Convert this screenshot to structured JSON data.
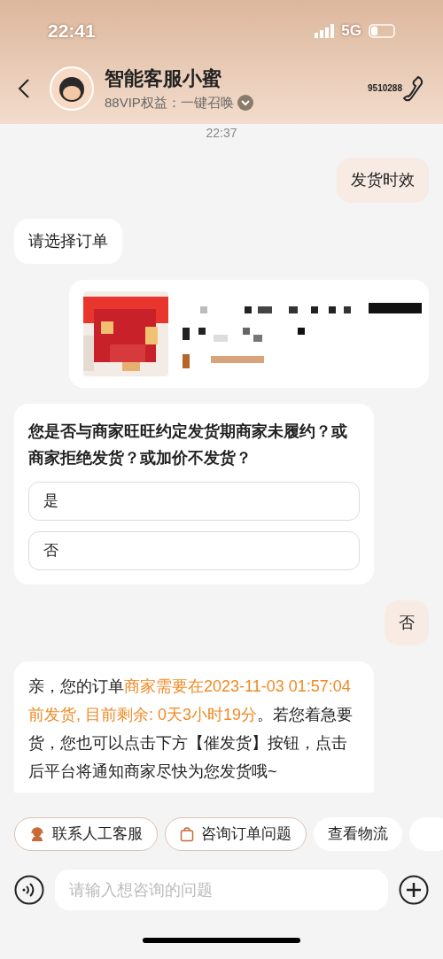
{
  "status_bar": {
    "time": "22:41",
    "network": "5G"
  },
  "header": {
    "title": "智能客服小蜜",
    "subtitle": "88VIP权益：一键召唤",
    "hotline": "9510288"
  },
  "timestamp": "22:37",
  "messages": [
    {
      "kind": "user_text",
      "text": "发货时效"
    },
    {
      "kind": "bot_text",
      "text": "请选择订单"
    },
    {
      "kind": "order_card"
    },
    {
      "kind": "bot_question",
      "text": "您是否与商家旺旺约定发货期商家未履约？或商家拒绝发货？或加价不发货？",
      "options": [
        "是",
        "否"
      ]
    },
    {
      "kind": "user_text",
      "text": "否"
    },
    {
      "kind": "bot_rich",
      "segments": [
        {
          "kind": "plain",
          "text": "亲，您的订单"
        },
        {
          "kind": "highlight",
          "text": "商家需要在2023-11-03 01:57:04前发货, 目前剩余: 0天3小时19分"
        },
        {
          "kind": "plain",
          "text": "。若您着急要货，您也可以点击下方【催发货】按钮，点击后平台将通知商家尽快为您发货哦~"
        }
      ]
    }
  ],
  "quick_replies": [
    {
      "kind": "agent",
      "label": "联系人工客服"
    },
    {
      "kind": "bag",
      "label": "咨询订单问题"
    },
    {
      "kind": "plain",
      "label": "查看物流"
    },
    {
      "kind": "plain"
    }
  ],
  "input": {
    "placeholder": "请输入想咨询的问题"
  }
}
